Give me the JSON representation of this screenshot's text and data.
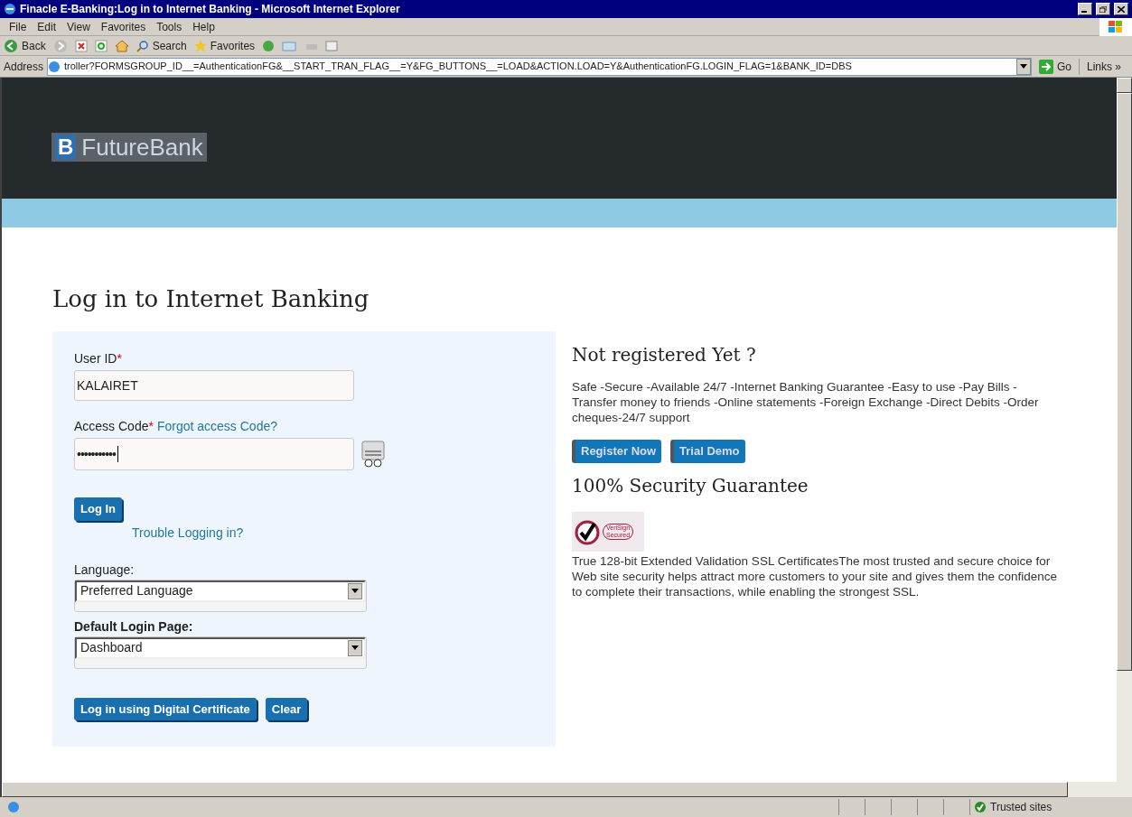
{
  "window": {
    "title": "Finacle E-Banking:Log in to Internet Banking - Microsoft Internet Explorer"
  },
  "menu": [
    "File",
    "Edit",
    "View",
    "Favorites",
    "Tools",
    "Help"
  ],
  "toolbar": {
    "back": "Back",
    "search": "Search",
    "favorites": "Favorites"
  },
  "address": {
    "label": "Address",
    "url": "troller?FORMSGROUP_ID__=AuthenticationFG&__START_TRAN_FLAG__=Y&FG_BUTTONS__=LOAD&ACTION.LOAD=Y&AuthenticationFG.LOGIN_FLAG=1&BANK_ID=DBS",
    "go": "Go",
    "links": "Links",
    "more": "»"
  },
  "page": {
    "logo_mark": "B",
    "logo_text": "FutureBank",
    "heading": "Log in to Internet Banking",
    "login": {
      "user_label": "User ID",
      "required": "*",
      "user_value": "KALAIRET",
      "code_label": "Access Code",
      "forgot": "Forgot access Code?",
      "code_value": "•••••••••••",
      "login_button": "Log In",
      "trouble": "Trouble Logging in?",
      "language_label": "Language:",
      "language_value": "Preferred Language",
      "default_label": "Default Login Page:",
      "default_value": "Dashboard",
      "buttons": [
        "Log in using Digital Certificate",
        "Clear"
      ]
    },
    "register": {
      "heading": "Not registered Yet ?",
      "text": "Safe -Secure -Available 24/7 -Internet Banking Guarantee -Easy to use -Pay Bills -Transfer money to friends -Online statements -Foreign Exchange -Direct Debits -Order cheques-24/7 support",
      "buttons": [
        "Register Now",
        "Trial Demo"
      ]
    },
    "security": {
      "heading": "100% Security Guarantee",
      "seal_lines": [
        "VeriSign",
        "Secured"
      ],
      "text": "True 128-bit Extended Validation SSL CertificatesThe most trusted and secure choice for Web site security helps attract more customers to your site and gives them the confidence to complete their transactions, while enabling the strongest SSL."
    }
  },
  "status_bar": {
    "zone": "Trusted sites"
  }
}
